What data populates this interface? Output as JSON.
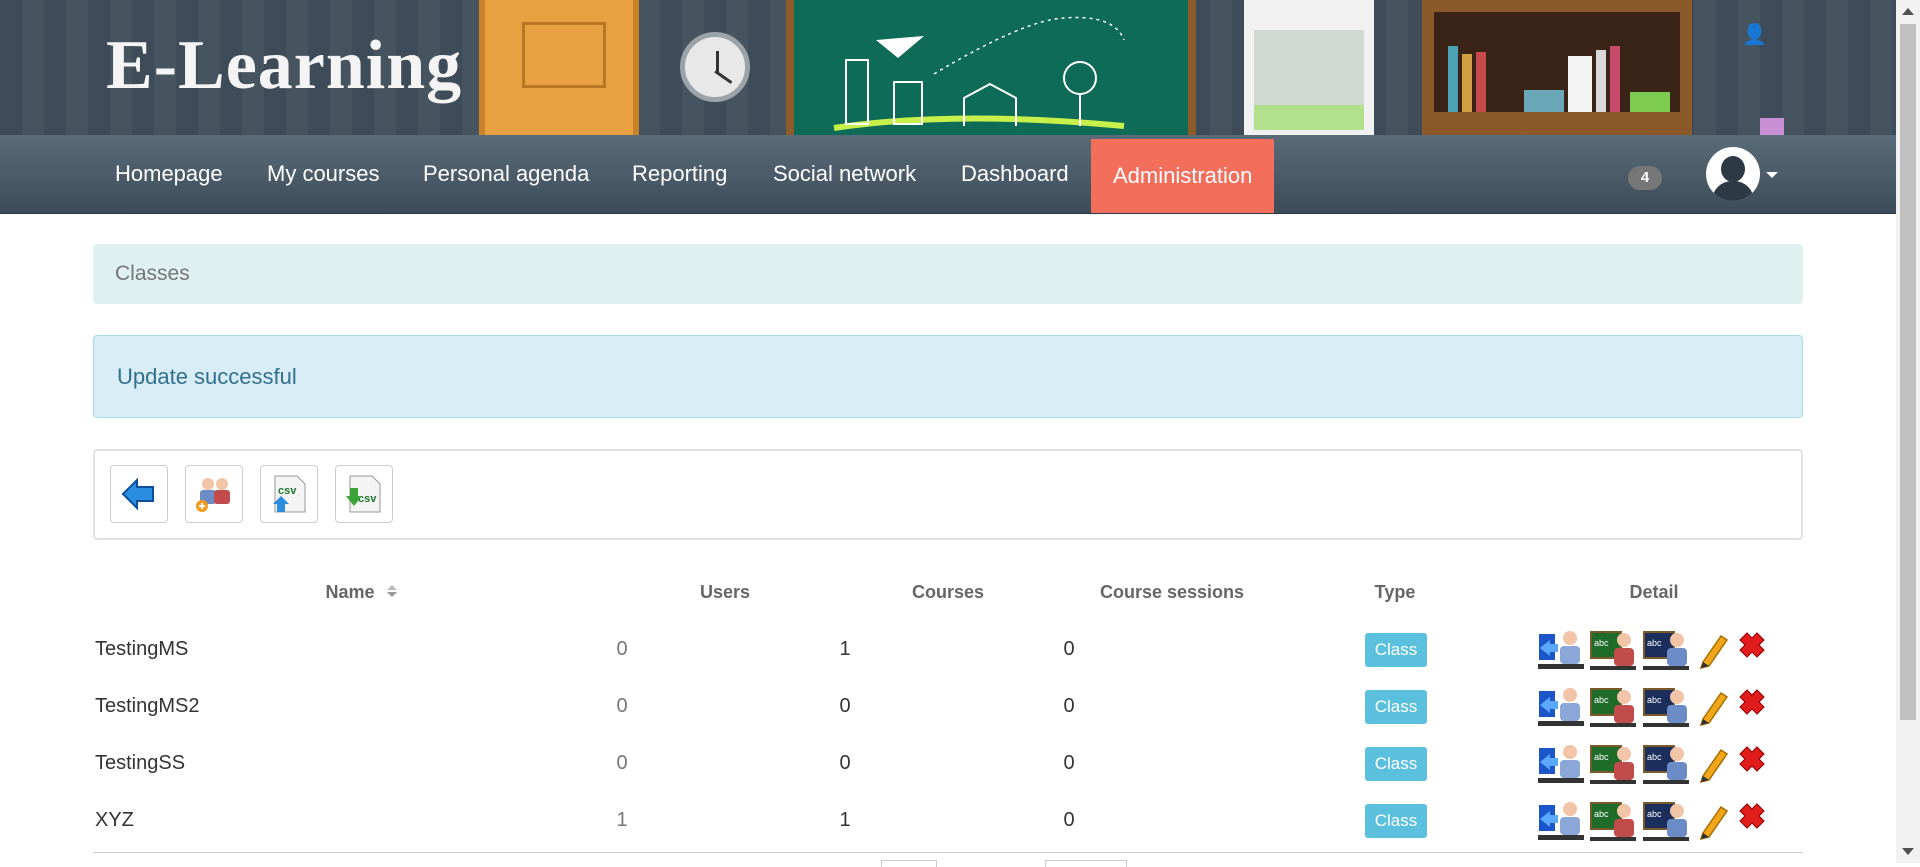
{
  "brand": {
    "logo_text": "E-Learning"
  },
  "nav": {
    "items": [
      {
        "label": "Homepage"
      },
      {
        "label": "My courses"
      },
      {
        "label": "Personal agenda"
      },
      {
        "label": "Reporting"
      },
      {
        "label": "Social network"
      },
      {
        "label": "Dashboard"
      },
      {
        "label": "Administration",
        "active": true
      }
    ],
    "notification_count": "4",
    "active_color": "#f46e5c"
  },
  "breadcrumb": {
    "current": "Classes"
  },
  "alert": {
    "message": "Update successful",
    "type": "info"
  },
  "toolbar": {
    "buttons": [
      {
        "icon": "back-arrow-icon"
      },
      {
        "icon": "add-class-icon"
      },
      {
        "icon": "csv-import-icon",
        "text": "csv"
      },
      {
        "icon": "csv-export-icon",
        "text": "csv"
      }
    ]
  },
  "table": {
    "columns": [
      "Name",
      "Users",
      "Courses",
      "Course sessions",
      "Type",
      "Detail"
    ],
    "sorted_by": "Name",
    "rows": [
      {
        "name": "TestingMS",
        "users": "0",
        "courses": "1",
        "sessions": "0",
        "type": "Class"
      },
      {
        "name": "TestingMS2",
        "users": "0",
        "courses": "0",
        "sessions": "0",
        "type": "Class"
      },
      {
        "name": "TestingSS",
        "users": "0",
        "courses": "0",
        "sessions": "0",
        "type": "Class"
      },
      {
        "name": "XYZ",
        "users": "1",
        "courses": "1",
        "sessions": "0",
        "type": "Class"
      }
    ],
    "row_actions": [
      "subscribe-users-icon",
      "subscribe-courses-icon",
      "subscribe-sessions-icon",
      "edit-pencil-icon",
      "delete-icon"
    ],
    "type_label_color": "#5bc0de"
  }
}
